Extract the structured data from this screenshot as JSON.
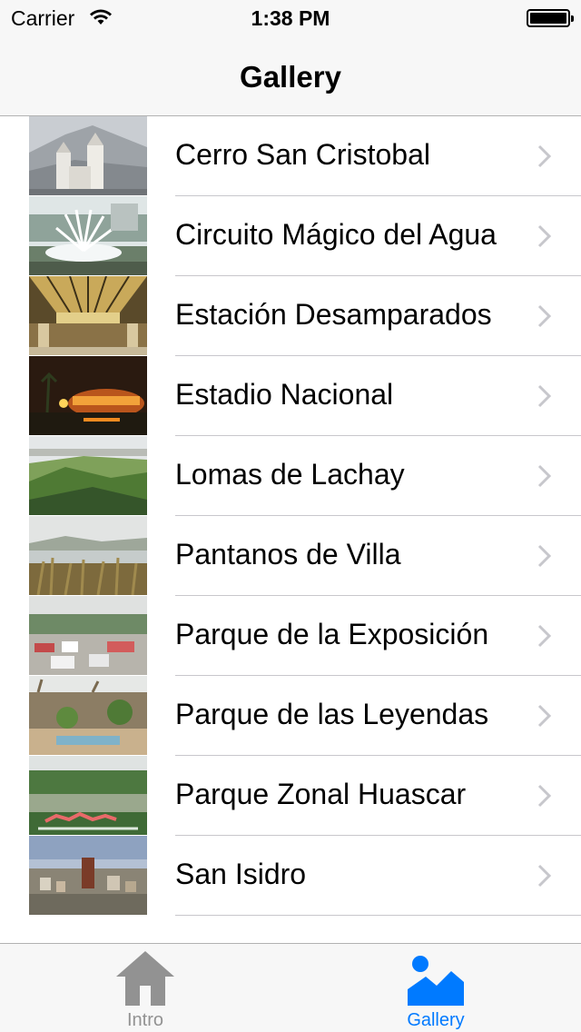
{
  "status_bar": {
    "carrier": "Carrier",
    "time": "1:38 PM"
  },
  "nav": {
    "title": "Gallery"
  },
  "gallery": {
    "items": [
      {
        "label": "Cerro San Cristobal"
      },
      {
        "label": "Circuito Mágico del Agua"
      },
      {
        "label": "Estación Desamparados"
      },
      {
        "label": "Estadio Nacional"
      },
      {
        "label": "Lomas de Lachay"
      },
      {
        "label": "Pantanos de Villa"
      },
      {
        "label": "Parque de la Exposición"
      },
      {
        "label": "Parque de las Leyendas"
      },
      {
        "label": "Parque Zonal Huascar"
      },
      {
        "label": "San Isidro"
      }
    ]
  },
  "tabbar": {
    "intro_label": "Intro",
    "intro_icon": "house-icon",
    "gallery_label": "Gallery",
    "gallery_icon": "landscape-icon",
    "active_tab": "Gallery",
    "active_color": "#007aff",
    "inactive_color": "#929292"
  }
}
